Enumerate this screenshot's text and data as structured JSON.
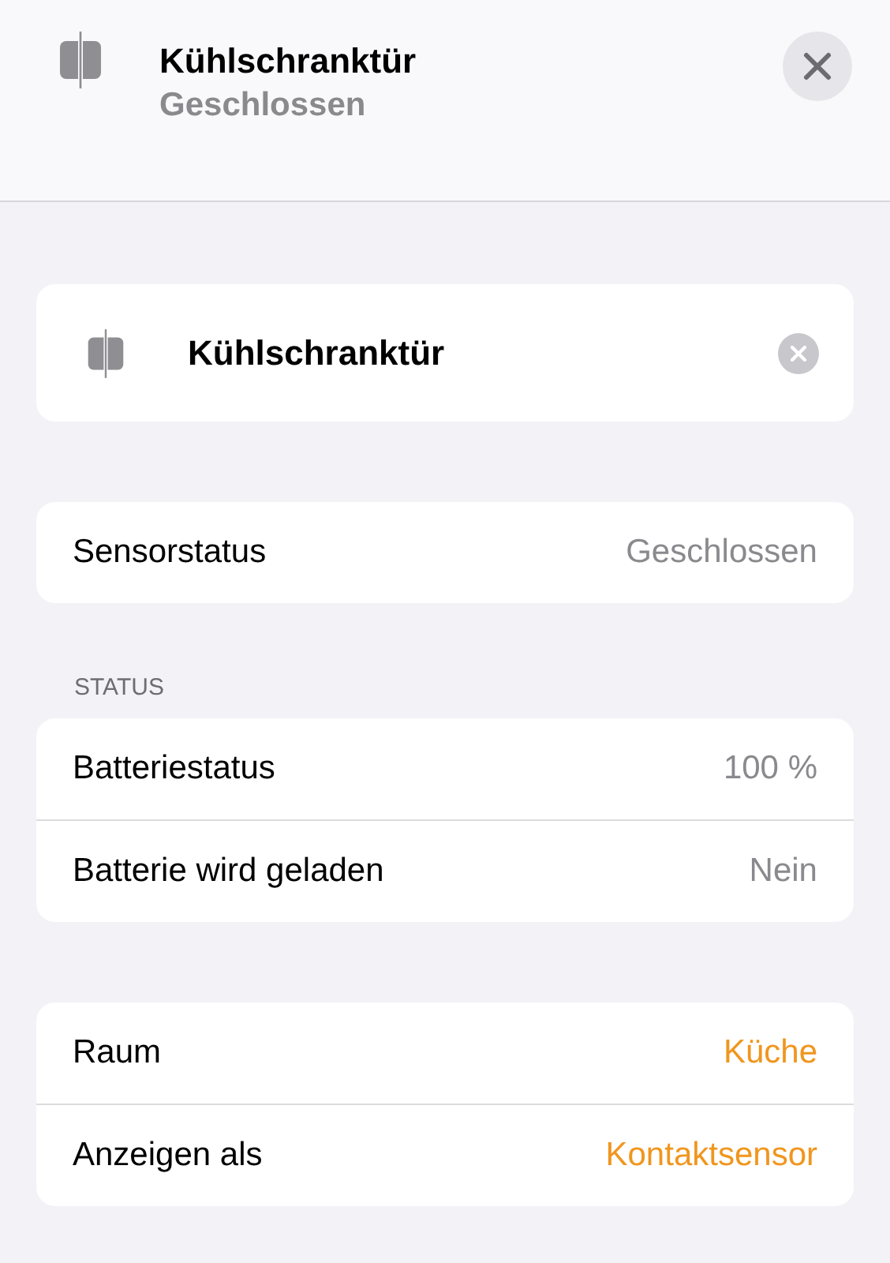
{
  "header": {
    "title": "Kühlschranktür",
    "subtitle": "Geschlossen"
  },
  "name_field": {
    "value": "Kühlschranktür"
  },
  "sections": [
    {
      "rows": [
        {
          "label": "Sensorstatus",
          "value": "Geschlossen",
          "kind": "value"
        }
      ]
    },
    {
      "title": "STATUS",
      "rows": [
        {
          "label": "Batteriestatus",
          "value": "100 %",
          "kind": "value"
        },
        {
          "label": "Batterie wird geladen",
          "value": "Nein",
          "kind": "value"
        }
      ]
    },
    {
      "rows": [
        {
          "label": "Raum",
          "value": "Küche",
          "kind": "picker"
        },
        {
          "label": "Anzeigen als",
          "value": "Kontaktsensor",
          "kind": "picker"
        }
      ]
    }
  ]
}
